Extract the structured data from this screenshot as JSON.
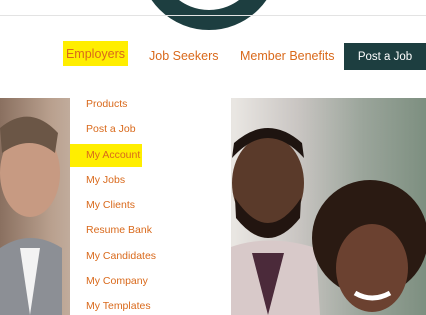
{
  "nav": {
    "employers": "Employers",
    "job_seekers": "Job Seekers",
    "member_benefits": "Member Benefits",
    "post_job_button": "Post a Job"
  },
  "dropdown": {
    "items": [
      "Products",
      "Post a Job",
      "My Account",
      "My Jobs",
      "My Clients",
      "Resume Bank",
      "My Candidates",
      "My Company",
      "My Templates"
    ]
  },
  "colors": {
    "accent_orange": "#d9691b",
    "brand_dark": "#1d3e40",
    "highlight_yellow": "#ffee00"
  }
}
